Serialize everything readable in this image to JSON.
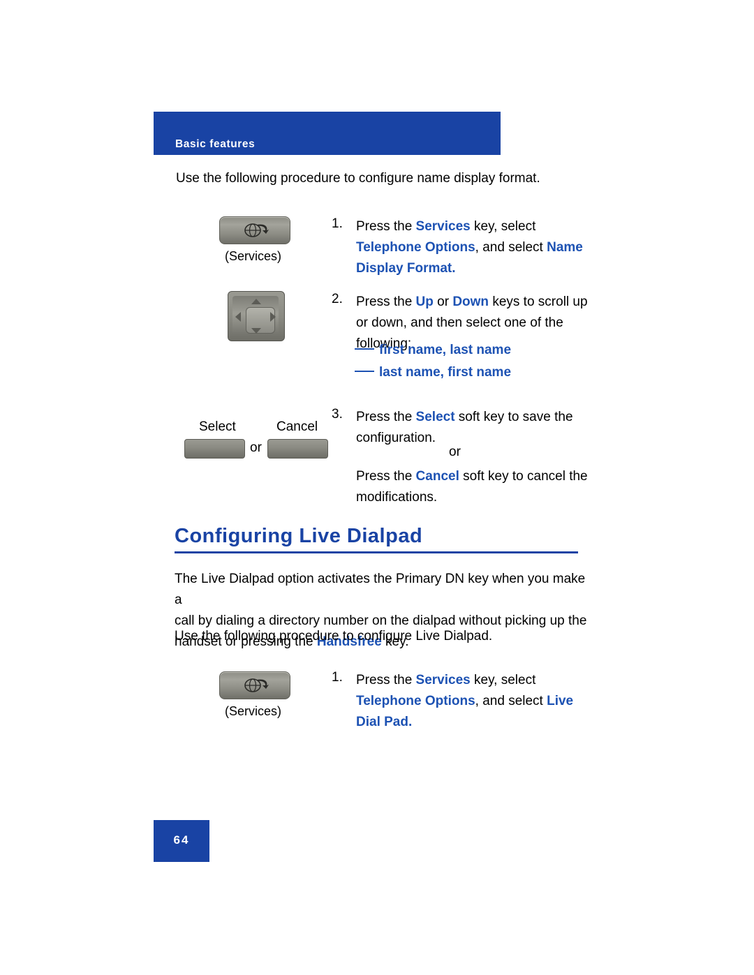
{
  "header": {
    "title": "Basic features"
  },
  "intro": {
    "name_display": "Use the following procedure to configure name display format.",
    "live_dialpad": "Use the following procedure to configure Live Dialpad."
  },
  "steps_name_display": [
    {
      "number": "1.",
      "line1_a": "Press the ",
      "line1_b": "Services",
      "line1_c": " key, select",
      "line2_a": "Telephone Options",
      "line2_b": ", and select ",
      "line2_c": "Name",
      "line3": "Display Format."
    },
    {
      "number": "2.",
      "line1_a": "Press the ",
      "line1_b": "Up",
      "line1_c": " or ",
      "line1_d": "Down",
      "line1_e": " keys to scroll up",
      "line2": "or down, and then select one of the",
      "line3": "following:"
    },
    {
      "number": "3.",
      "line1_a": "Press the ",
      "line1_b": "Select",
      "line1_c": " soft key to save the",
      "line2": "configuration.",
      "or": "or",
      "line3_a": "Press the ",
      "line3_b": "Cancel",
      "line3_c": " soft key to cancel the",
      "line4": "modifications."
    }
  ],
  "bullets": [
    "first name, last name",
    "last name, first name"
  ],
  "keys": {
    "services_label": "(Services)",
    "select_label": "Select",
    "cancel_label": "Cancel",
    "or_label": "or"
  },
  "section": {
    "heading": "Configuring Live Dialpad",
    "para_line1_a": "The Live Dialpad option activates the Primary DN key when you make a",
    "para_line2_a": "call by dialing a directory number on the dialpad without picking up the",
    "para_line3_a": "handset or pressing the ",
    "para_line3_b": "Handsfree",
    "para_line3_c": " key."
  },
  "steps_live_dialpad": [
    {
      "number": "1.",
      "line1_a": "Press the ",
      "line1_b": "Services",
      "line1_c": " key, select",
      "line2_a": "Telephone Options",
      "line2_b": ", and select ",
      "line2_c": "Live",
      "line3": "Dial Pad."
    }
  ],
  "footer": {
    "page_number": "64"
  },
  "colors": {
    "brand_blue": "#1943a4",
    "text_blue": "#1d52b3"
  }
}
